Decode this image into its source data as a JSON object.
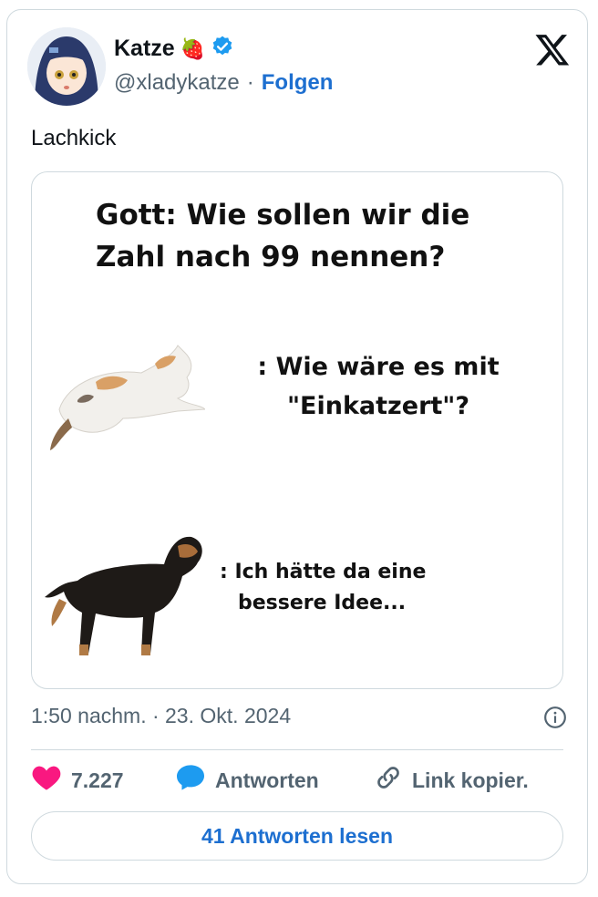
{
  "author": {
    "name": "Katze",
    "name_emoji": "🍓",
    "verified_color": "#1d9bf0",
    "handle": "@xladykatze",
    "separator": "·",
    "follow_label": "Folgen"
  },
  "tweet": {
    "text": "Lachkick"
  },
  "media": {
    "headline_line1": "Gott: Wie sollen wir die",
    "headline_line2": "Zahl nach 99 nennen?",
    "cat_reply_line1": ": Wie wäre es mit",
    "cat_reply_line2": "\"Einkatzert\"?",
    "dog_reply_line1": ": Ich hätte da eine",
    "dog_reply_line2": "bessere Idee..."
  },
  "meta": {
    "timestamp": "1:50 nachm. · 23. Okt. 2024"
  },
  "actions": {
    "like_count": "7.227",
    "reply_label": "Antworten",
    "copy_link_label": "Link kopier."
  },
  "read_replies_label": "41 Antworten lesen",
  "colors": {
    "accent": "#1d6fd0",
    "like": "#f91880",
    "reply_bubble": "#1d9bf0",
    "muted": "#536471",
    "border": "#cfd9de"
  },
  "icons": [
    "verified-badge-icon",
    "x-logo-icon",
    "info-icon",
    "heart-icon",
    "reply-bubble-icon",
    "link-icon"
  ]
}
